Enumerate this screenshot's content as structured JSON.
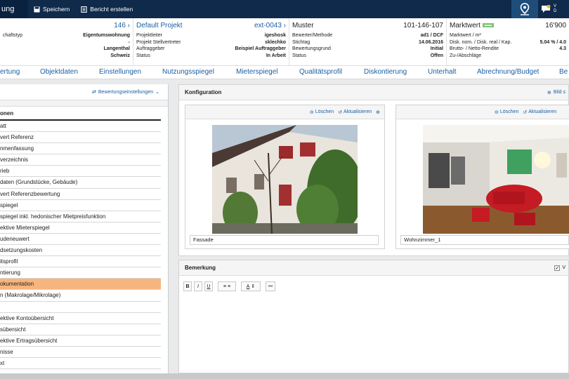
{
  "app": {
    "title_fragment": "ung"
  },
  "toolbar": {
    "save": "Speichern",
    "report": "Bericht erstellen"
  },
  "topbar_right": {
    "chat_text_1": "V",
    "chat_text_2": "D"
  },
  "info": {
    "col1": {
      "head_left": "",
      "head_num": "146",
      "rows": [
        {
          "l": "chaftstyp",
          "v": "Eigentumswohnung"
        },
        {
          "l": "",
          "v": "-"
        },
        {
          "l": "",
          "v": "Langenthal"
        },
        {
          "l": "",
          "v": "Schweiz"
        }
      ]
    },
    "col2": {
      "head_left": "Default Projekt",
      "head_right": "ext-0043",
      "rows": [
        {
          "l": "Projektleiter",
          "v": "igeshosk"
        },
        {
          "l": "Projekt Stellvertreter",
          "v": "sklechko"
        },
        {
          "l": "Auftraggeber",
          "v": "Beispiel Auftraggeber"
        },
        {
          "l": "Status",
          "v": "In Arbeit"
        }
      ]
    },
    "col3": {
      "head_left": "Muster",
      "head_right": "101-146-107",
      "rows": [
        {
          "l": "Bewerter/Methode",
          "v": "ad1 / DCF"
        },
        {
          "l": "Stichtag",
          "v": "14.06.2016"
        },
        {
          "l": "Bewertungsgrund",
          "v": "Initial"
        },
        {
          "l": "Status",
          "v": "Offen"
        }
      ]
    },
    "col4": {
      "head_left": "Marktwert",
      "head_right": "16'900",
      "rows": [
        {
          "l": "Marktwert / m²",
          "v": ""
        },
        {
          "l": "Disk. nom. / Disk. real / Kap.",
          "v": "5.04 % / 4.0"
        },
        {
          "l": "Brutto- / Netto-Rendite",
          "v": "4.3"
        },
        {
          "l": "Zu-/Abschläge",
          "v": ""
        }
      ]
    }
  },
  "tabs": [
    "ertung",
    "Objektdaten",
    "Einstellungen",
    "Nutzungsspiegel",
    "Mieterspiegel",
    "Qualitätsprofil",
    "Diskontierung",
    "Unterhalt",
    "Abrechnung/Budget",
    "Be"
  ],
  "left": {
    "settings_label": "Bewertungseinstellungen",
    "list_title": "onen",
    "items": [
      "att",
      "vert Referenz",
      "nmenfassung",
      "verzeichnis",
      "rieb",
      "daten (Grundstücke, Gebäude)",
      "vert Referenzbewertung",
      "spiegel",
      "spiegel inkl. hedonischer Mietpreisfunktion",
      "ektive Mieterspiegel",
      "udeneuwert",
      "dsetzungskosten",
      "itsprofil",
      "ntierung",
      "okumentation",
      "n (Makrolage/Mikrolage)",
      "",
      "ektive Kontoübersicht",
      "sübersicht",
      "ektive Ertragsübersicht",
      "nisse",
      "xt"
    ],
    "active_index": 14
  },
  "config": {
    "title": "Konfiguration",
    "right_action": "Bild s",
    "delete": "Löschen",
    "refresh": "Aktualisieren",
    "img1_caption": "Fassade",
    "img2_caption": "Wohnzimmer_1"
  },
  "remark": {
    "title": "Bemerkung",
    "right_label": "V",
    "tb_bold": "B",
    "tb_italic": "I",
    "tb_underline": "U"
  }
}
